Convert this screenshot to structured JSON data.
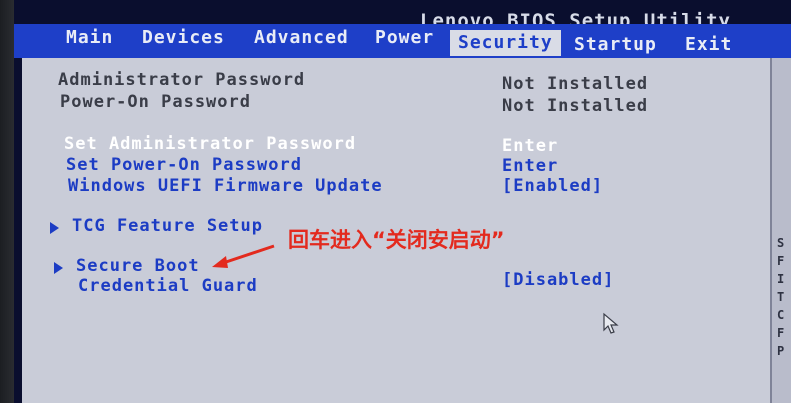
{
  "header": {
    "title": "Lenovo BIOS Setup Utility"
  },
  "menu": [
    {
      "label": "Main"
    },
    {
      "label": "Devices"
    },
    {
      "label": "Advanced"
    },
    {
      "label": "Power"
    },
    {
      "label": "Security"
    },
    {
      "label": "Startup"
    },
    {
      "label": "Exit"
    }
  ],
  "active_menu": "Security",
  "settings": {
    "admin_password": {
      "label": "Administrator Password",
      "value": "Not Installed"
    },
    "poweron_password": {
      "label": "Power-On Password",
      "value": "Not Installed"
    },
    "set_admin_password": {
      "label": "Set Administrator Password",
      "value": "Enter"
    },
    "set_poweron_password": {
      "label": "Set Power-On Password",
      "value": "Enter"
    },
    "uefi_firmware_update": {
      "label": "Windows UEFI Firmware Update",
      "value": "[Enabled]"
    },
    "tcg_feature_setup": {
      "label": "TCG Feature Setup"
    },
    "secure_boot": {
      "label": "Secure Boot"
    },
    "credential_guard": {
      "label": "Credential Guard",
      "value": "[Disabled]"
    }
  },
  "annotation": {
    "text": "回车进入“关闭安启动”",
    "color": "#e32a1e"
  },
  "help_strip": [
    "S",
    "F",
    "I",
    "T",
    "C",
    "F",
    "P"
  ],
  "colors": {
    "menu_bar": "#1e3fc8",
    "panel": "#c9ccd8",
    "link_text": "#1c3cc4",
    "selected_text": "#ffffff"
  }
}
